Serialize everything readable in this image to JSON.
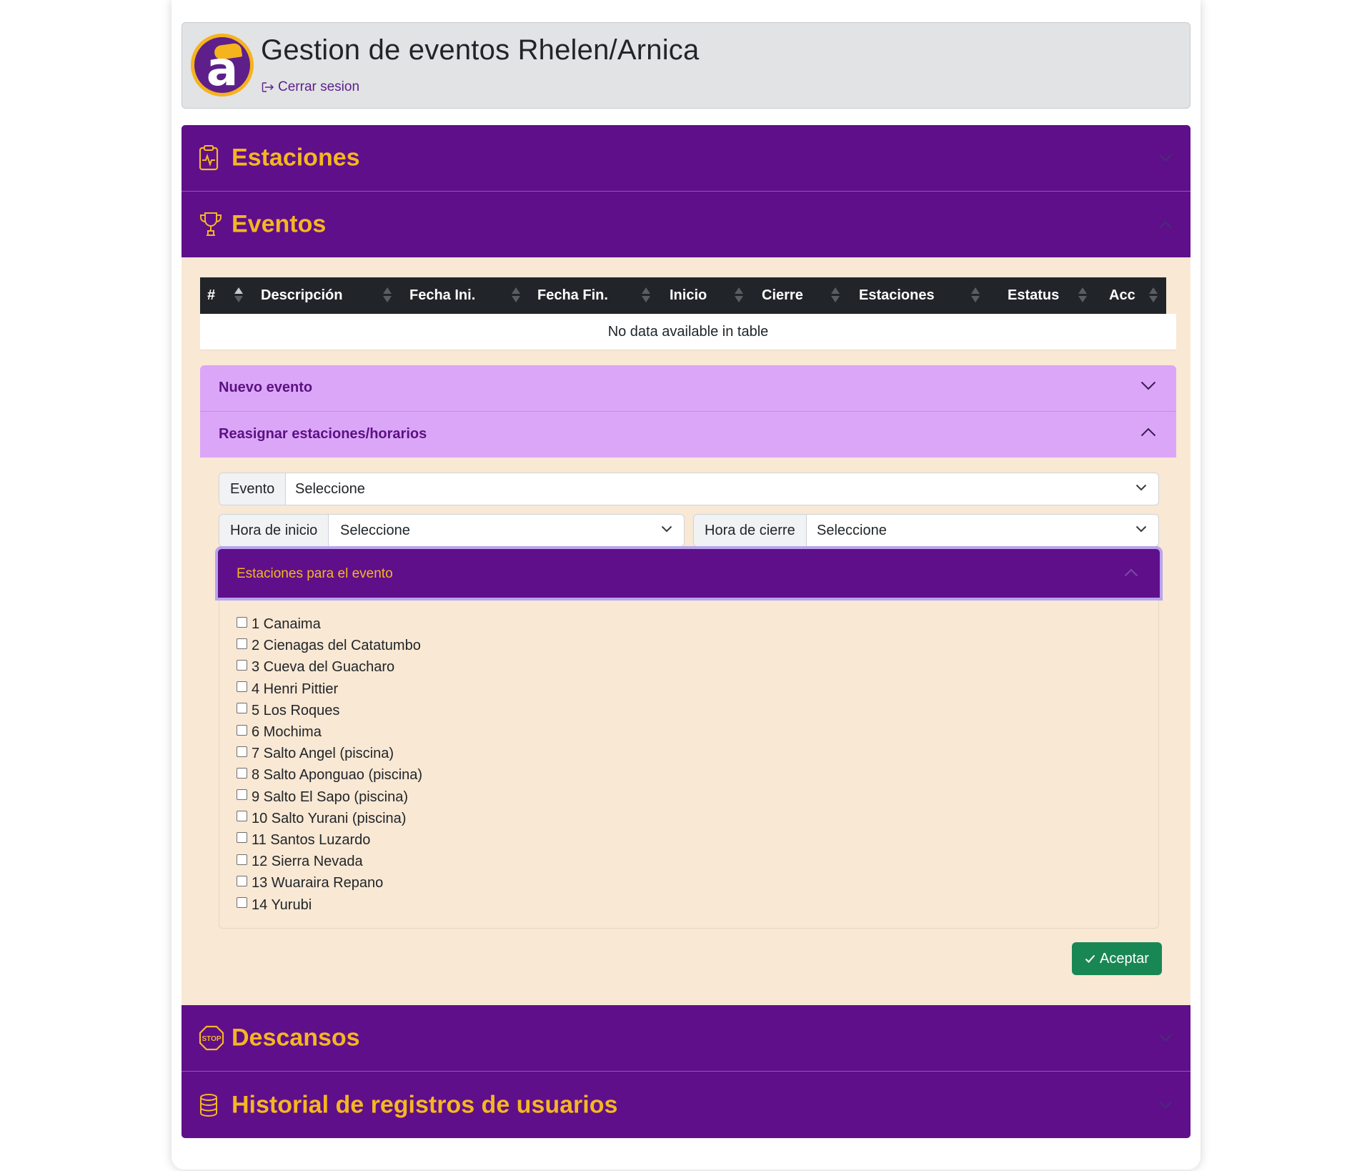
{
  "header": {
    "title": "Gestion de eventos Rhelen/Arnica",
    "logo_letter": "a",
    "logout_label": "Cerrar sesion"
  },
  "sections": {
    "estaciones": "Estaciones",
    "eventos": "Eventos",
    "descansos": "Descansos",
    "historial": "Historial de registros de usuarios"
  },
  "table": {
    "columns": [
      "#",
      "Descripción",
      "Fecha Ini.",
      "Fecha Fin.",
      "Inicio",
      "Cierre",
      "Estaciones",
      "Estatus",
      "Acc"
    ],
    "empty_message": "No data available in table"
  },
  "inner_accordion": {
    "nuevo_evento": "Nuevo evento",
    "reasignar": "Reasignar estaciones/horarios"
  },
  "form": {
    "evento_label": "Evento",
    "evento_value": "Seleccione",
    "hora_inicio_label": "Hora de inicio",
    "hora_inicio_value": "Seleccione",
    "hora_cierre_label": "Hora de cierre",
    "hora_cierre_value": "Seleccione"
  },
  "estaciones_panel": {
    "title": "Estaciones para el evento",
    "items": [
      "1 Canaima",
      "2 Cienagas del Catatumbo",
      "3 Cueva del Guacharo",
      "4 Henri Pittier",
      "5 Los Roques",
      "6 Mochima",
      "7 Salto Angel (piscina)",
      "8 Salto Aponguao (piscina)",
      "9 Salto El Sapo (piscina)",
      "10 Salto Yurani (piscina)",
      "11 Santos Luzardo",
      "12 Sierra Nevada",
      "13 Wuaraira Repano",
      "14 Yurubi"
    ],
    "submit_label": "Aceptar"
  },
  "colors": {
    "primary_purple": "#5f0f8a",
    "accent_gold": "#f5b621",
    "light_purple": "#dba6f8",
    "panel_bg": "#f8e8d4",
    "success_green": "#198754"
  }
}
